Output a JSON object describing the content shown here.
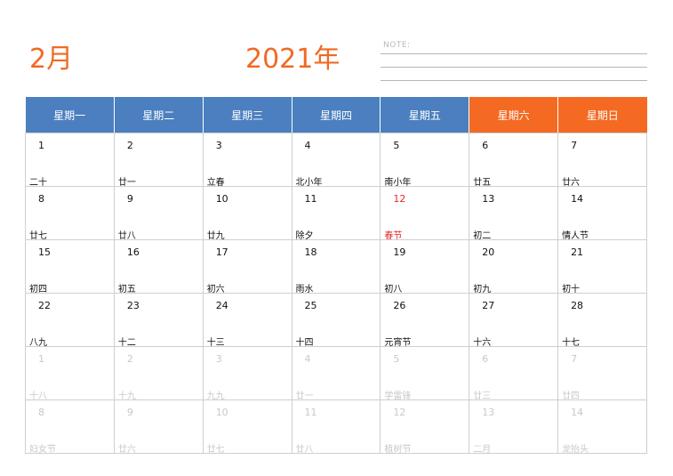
{
  "header": {
    "month": "2月",
    "year": "2021年",
    "note_label": "NOTE:"
  },
  "weekdays": [
    "星期一",
    "星期二",
    "星期三",
    "星期四",
    "星期五",
    "星期六",
    "星期日"
  ],
  "weeks": [
    [
      {
        "day": "1",
        "lunar": "二十",
        "state": "normal"
      },
      {
        "day": "2",
        "lunar": "廿一",
        "state": "normal"
      },
      {
        "day": "3",
        "lunar": "立春",
        "state": "normal"
      },
      {
        "day": "4",
        "lunar": "北小年",
        "state": "normal"
      },
      {
        "day": "5",
        "lunar": "南小年",
        "state": "normal"
      },
      {
        "day": "6",
        "lunar": "廿五",
        "state": "normal"
      },
      {
        "day": "7",
        "lunar": "廿六",
        "state": "normal"
      }
    ],
    [
      {
        "day": "8",
        "lunar": "廿七",
        "state": "normal"
      },
      {
        "day": "9",
        "lunar": "廿八",
        "state": "normal"
      },
      {
        "day": "10",
        "lunar": "廿九",
        "state": "normal"
      },
      {
        "day": "11",
        "lunar": "除夕",
        "state": "normal"
      },
      {
        "day": "12",
        "lunar": "春节",
        "state": "holiday"
      },
      {
        "day": "13",
        "lunar": "初二",
        "state": "normal"
      },
      {
        "day": "14",
        "lunar": "情人节",
        "state": "normal"
      }
    ],
    [
      {
        "day": "15",
        "lunar": "初四",
        "state": "normal"
      },
      {
        "day": "16",
        "lunar": "初五",
        "state": "normal"
      },
      {
        "day": "17",
        "lunar": "初六",
        "state": "normal"
      },
      {
        "day": "18",
        "lunar": "雨水",
        "state": "normal"
      },
      {
        "day": "19",
        "lunar": "初八",
        "state": "normal"
      },
      {
        "day": "20",
        "lunar": "初九",
        "state": "normal"
      },
      {
        "day": "21",
        "lunar": "初十",
        "state": "normal"
      }
    ],
    [
      {
        "day": "22",
        "lunar": "八九",
        "state": "normal"
      },
      {
        "day": "23",
        "lunar": "十二",
        "state": "normal"
      },
      {
        "day": "24",
        "lunar": "十三",
        "state": "normal"
      },
      {
        "day": "25",
        "lunar": "十四",
        "state": "normal"
      },
      {
        "day": "26",
        "lunar": "元宵节",
        "state": "normal"
      },
      {
        "day": "27",
        "lunar": "十六",
        "state": "normal"
      },
      {
        "day": "28",
        "lunar": "十七",
        "state": "normal"
      }
    ],
    [
      {
        "day": "1",
        "lunar": "十八",
        "state": "muted"
      },
      {
        "day": "2",
        "lunar": "十九",
        "state": "muted"
      },
      {
        "day": "3",
        "lunar": "九九",
        "state": "muted"
      },
      {
        "day": "4",
        "lunar": "廿一",
        "state": "muted"
      },
      {
        "day": "5",
        "lunar": "学雷锋",
        "state": "muted"
      },
      {
        "day": "6",
        "lunar": "廿三",
        "state": "muted"
      },
      {
        "day": "7",
        "lunar": "廿四",
        "state": "muted"
      }
    ],
    [
      {
        "day": "8",
        "lunar": "妇女节",
        "state": "muted"
      },
      {
        "day": "9",
        "lunar": "廿六",
        "state": "muted"
      },
      {
        "day": "10",
        "lunar": "廿七",
        "state": "muted"
      },
      {
        "day": "11",
        "lunar": "廿八",
        "state": "muted"
      },
      {
        "day": "12",
        "lunar": "植树节",
        "state": "muted"
      },
      {
        "day": "13",
        "lunar": "二月",
        "state": "muted"
      },
      {
        "day": "14",
        "lunar": "龙抬头",
        "state": "muted"
      }
    ]
  ],
  "colors": {
    "title_orange": "#f06a22",
    "weekday_header_blue": "#4b7fbf",
    "weekend_header_orange": "#f46a22",
    "holiday_red": "#e8262b",
    "muted_gray": "#c8c8c8",
    "grid_gray": "#cfcfcf"
  }
}
